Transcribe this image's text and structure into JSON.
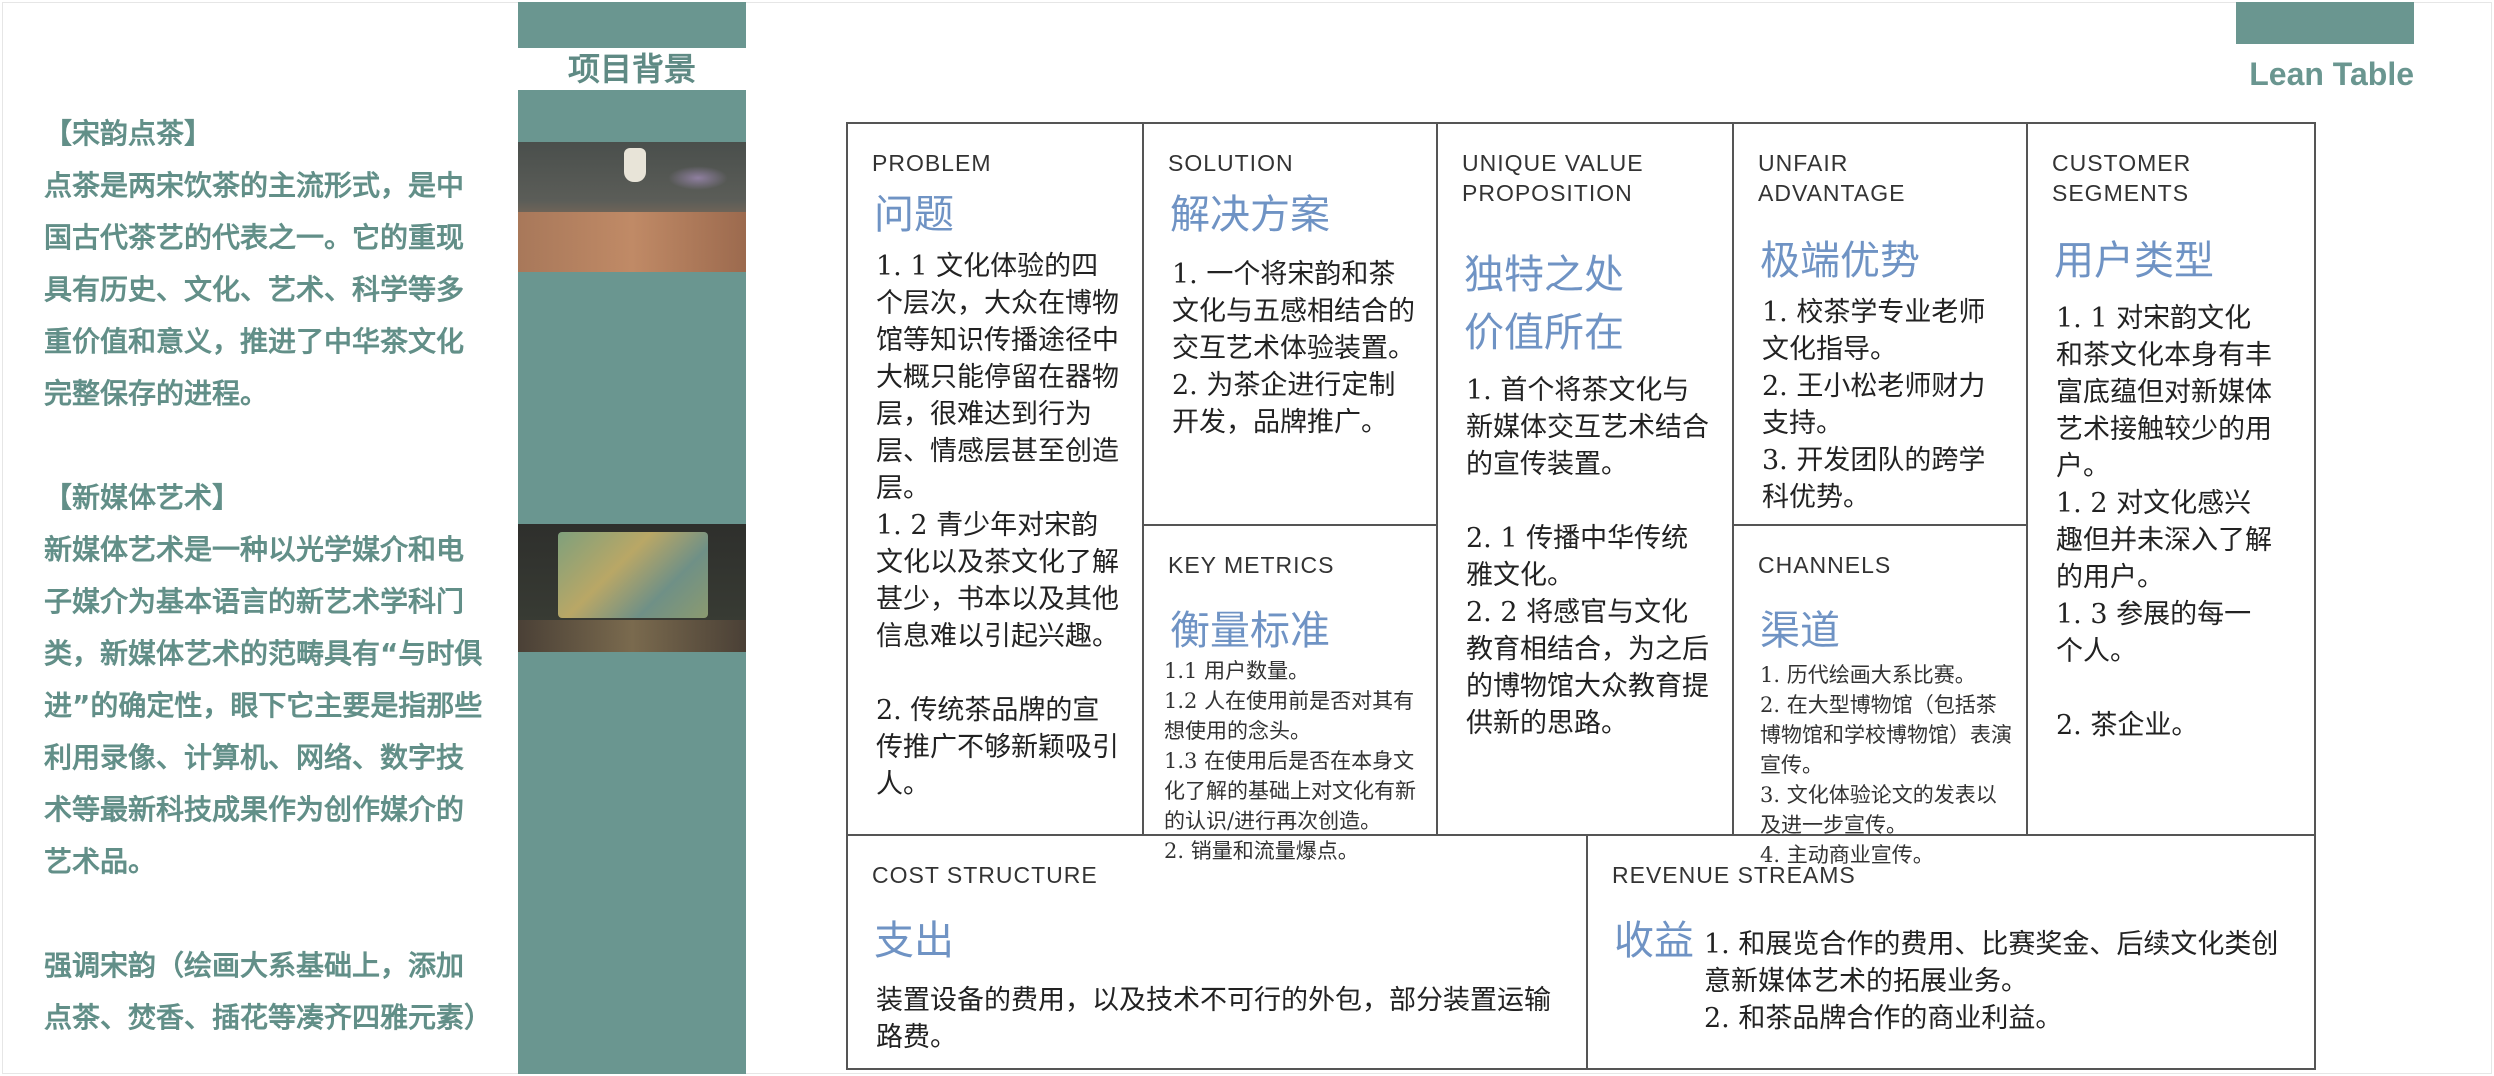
{
  "left": {
    "p1": "【宋韵点茶】\n点茶是两宋饮茶的主流形式，是中国古代茶艺的代表之一。它的重现具有历史、文化、艺术、科学等多重价值和意义，推进了中华茶文化完整保存的进程。",
    "p2": "【新媒体艺术】\n新媒体艺术是一种以光学媒介和电子媒介为基本语言的新艺术学科门类，新媒体艺术的范畴具有“与时俱进”的确定性，眼下它主要是指那些利用录像、计算机、网络、数字技术等最新科技成果作为创作媒介的艺术品。",
    "p3": "强调宋韵（绘画大系基础上，添加点茶、焚香、插花等凑齐四雅元素）"
  },
  "strip_title": "项目背景",
  "lean_title": "Lean Table",
  "colors": {
    "teal": "#6a9690",
    "heading_blue": "#6f93c4"
  },
  "canvas": {
    "problem": {
      "head": "PROBLEM",
      "cn": "问题",
      "body": "1. 1 文化体验的四个层次，大众在博物馆等知识传播途径中大概只能停留在器物层，很难达到行为层、情感层甚至创造层。\n1. 2 青少年对宋韵文化以及茶文化了解甚少，书本以及其他信息难以引起兴趣。\n\n2. 传统茶品牌的宣传推广不够新颖吸引人。"
    },
    "solution": {
      "head": "SOLUTION",
      "cn": "解决方案",
      "body": "1. 一个将宋韵和茶文化与五感相结合的交互艺术体验装置。\n2. 为茶企进行定制开发，品牌推广。"
    },
    "key_metrics": {
      "head": "KEY METRICS",
      "cn": "衡量标准",
      "body": "1.1 用户数量。\n1.2 人在使用前是否对其有想使用的念头。\n1.3 在使用后是否在本身文化了解的基础上对文化有新的认识/进行再次创造。\n2. 销量和流量爆点。"
    },
    "uvp": {
      "head": "UNIQUE VALUE\nPROPOSITION",
      "cn": "独特之处\n价值所在",
      "body": "1. 首个将茶文化与新媒体交互艺术结合的宣传装置。\n\n2. 1 传播中华传统雅文化。\n2. 2 将感官与文化教育相结合，为之后的博物馆大众教育提供新的思路。"
    },
    "unfair": {
      "head": "UNFAIR\nADVANTAGE",
      "cn": "极端优势",
      "body": "1. 校茶学专业老师文化指导。\n2. 王小松老师财力支持。\n3. 开发团队的跨学科优势。"
    },
    "channels": {
      "head": "CHANNELS",
      "cn": "渠道",
      "body": "1. 历代绘画大系比赛。\n2. 在大型博物馆（包括茶博物馆和学校博物馆）表演宣传。\n3. 文化体验论文的发表以及进一步宣传。\n4. 主动商业宣传。"
    },
    "customer": {
      "head": "CUSTOMER\nSEGMENTS",
      "cn": "用户类型",
      "body": "1. 1 对宋韵文化和茶文化本身有丰富底蕴但对新媒体艺术接触较少的用户。\n1. 2 对文化感兴趣但并未深入了解的用户。\n1. 3 参展的每一个人。\n\n2. 茶企业。"
    },
    "cost": {
      "head": "COST STRUCTURE",
      "cn": "支出",
      "body": "装置设备的费用，以及技术不可行的外包，部分装置运输路费。"
    },
    "revenue": {
      "head": "REVENUE STREAMS",
      "cn": "收益",
      "body": "1. 和展览合作的费用、比赛奖金、后续文化类创意新媒体艺术的拓展业务。\n2. 和茶品牌合作的商业利益。"
    }
  }
}
